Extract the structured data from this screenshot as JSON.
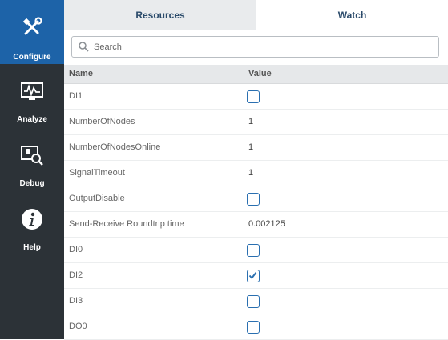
{
  "sidebar": {
    "items": [
      {
        "label": "Configure",
        "icon": "tools-icon",
        "active": true
      },
      {
        "label": "Analyze",
        "icon": "waveform-monitor-icon",
        "active": false
      },
      {
        "label": "Debug",
        "icon": "debug-search-icon",
        "active": false
      },
      {
        "label": "Help",
        "icon": "info-icon",
        "active": false
      }
    ]
  },
  "tabs": [
    {
      "label": "Resources",
      "active": false
    },
    {
      "label": "Watch",
      "active": true
    }
  ],
  "search": {
    "placeholder": "Search",
    "value": ""
  },
  "table": {
    "headers": {
      "name": "Name",
      "value": "Value"
    },
    "rows": [
      {
        "name": "DI1",
        "type": "checkbox",
        "checked": false
      },
      {
        "name": "NumberOfNodes",
        "type": "text",
        "value": "1"
      },
      {
        "name": "NumberOfNodesOnline",
        "type": "text",
        "value": "1"
      },
      {
        "name": "SignalTimeout",
        "type": "text",
        "value": "1"
      },
      {
        "name": "OutputDisable",
        "type": "checkbox",
        "checked": false
      },
      {
        "name": "Send-Receive Roundtrip time",
        "type": "text",
        "value": "0.002125"
      },
      {
        "name": "DI0",
        "type": "checkbox",
        "checked": false
      },
      {
        "name": "DI2",
        "type": "checkbox",
        "checked": true
      },
      {
        "name": "DI3",
        "type": "checkbox",
        "checked": false
      },
      {
        "name": "DO0",
        "type": "checkbox",
        "checked": false
      }
    ]
  },
  "colors": {
    "accent": "#1d63a8",
    "sidebar": "#2c3237",
    "checkbox": "#2a6fb0"
  }
}
